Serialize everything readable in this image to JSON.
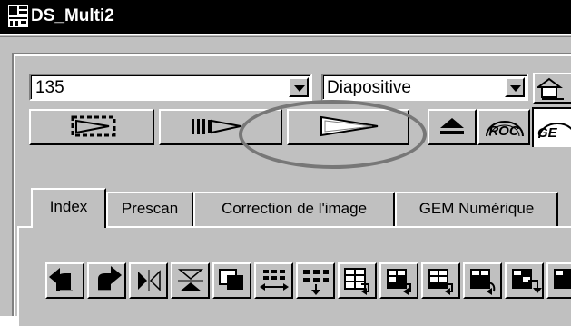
{
  "window": {
    "title": "DS_Multi2",
    "app_icon": "ds-multi-app-icon"
  },
  "controls": {
    "film_format": {
      "value": "135"
    },
    "film_type": {
      "value": "Diapositive"
    }
  },
  "transport": {
    "buttons": [
      {
        "name": "index-scan-button",
        "icon": "film-strip-play-icon"
      },
      {
        "name": "prescan-button",
        "icon": "film-advance-icon"
      },
      {
        "name": "scan-button",
        "icon": "play-triangle-icon"
      },
      {
        "name": "eject-button",
        "icon": "eject-icon"
      },
      {
        "name": "roc-button",
        "icon": "roc-logo-icon",
        "label": "ROC"
      },
      {
        "name": "gem-button",
        "icon": "gem-logo-icon",
        "label": "GE"
      }
    ]
  },
  "tabs": [
    {
      "label": "Index",
      "active": true
    },
    {
      "label": "Prescan",
      "active": false
    },
    {
      "label": "Correction de l'image",
      "active": false
    },
    {
      "label": "GEM Numérique",
      "active": false
    }
  ],
  "toolbar": {
    "icons": [
      "rotate-left-icon",
      "rotate-right-icon",
      "flip-horizontal-icon",
      "flip-vertical-icon",
      "frame-select-icon",
      "swap-icon",
      "grid-sort-icon",
      "batch-export-icon",
      "batch-export-2-icon",
      "batch-export-3-icon"
    ]
  },
  "annotation": {
    "target": "scan-button",
    "color": "#777777"
  }
}
